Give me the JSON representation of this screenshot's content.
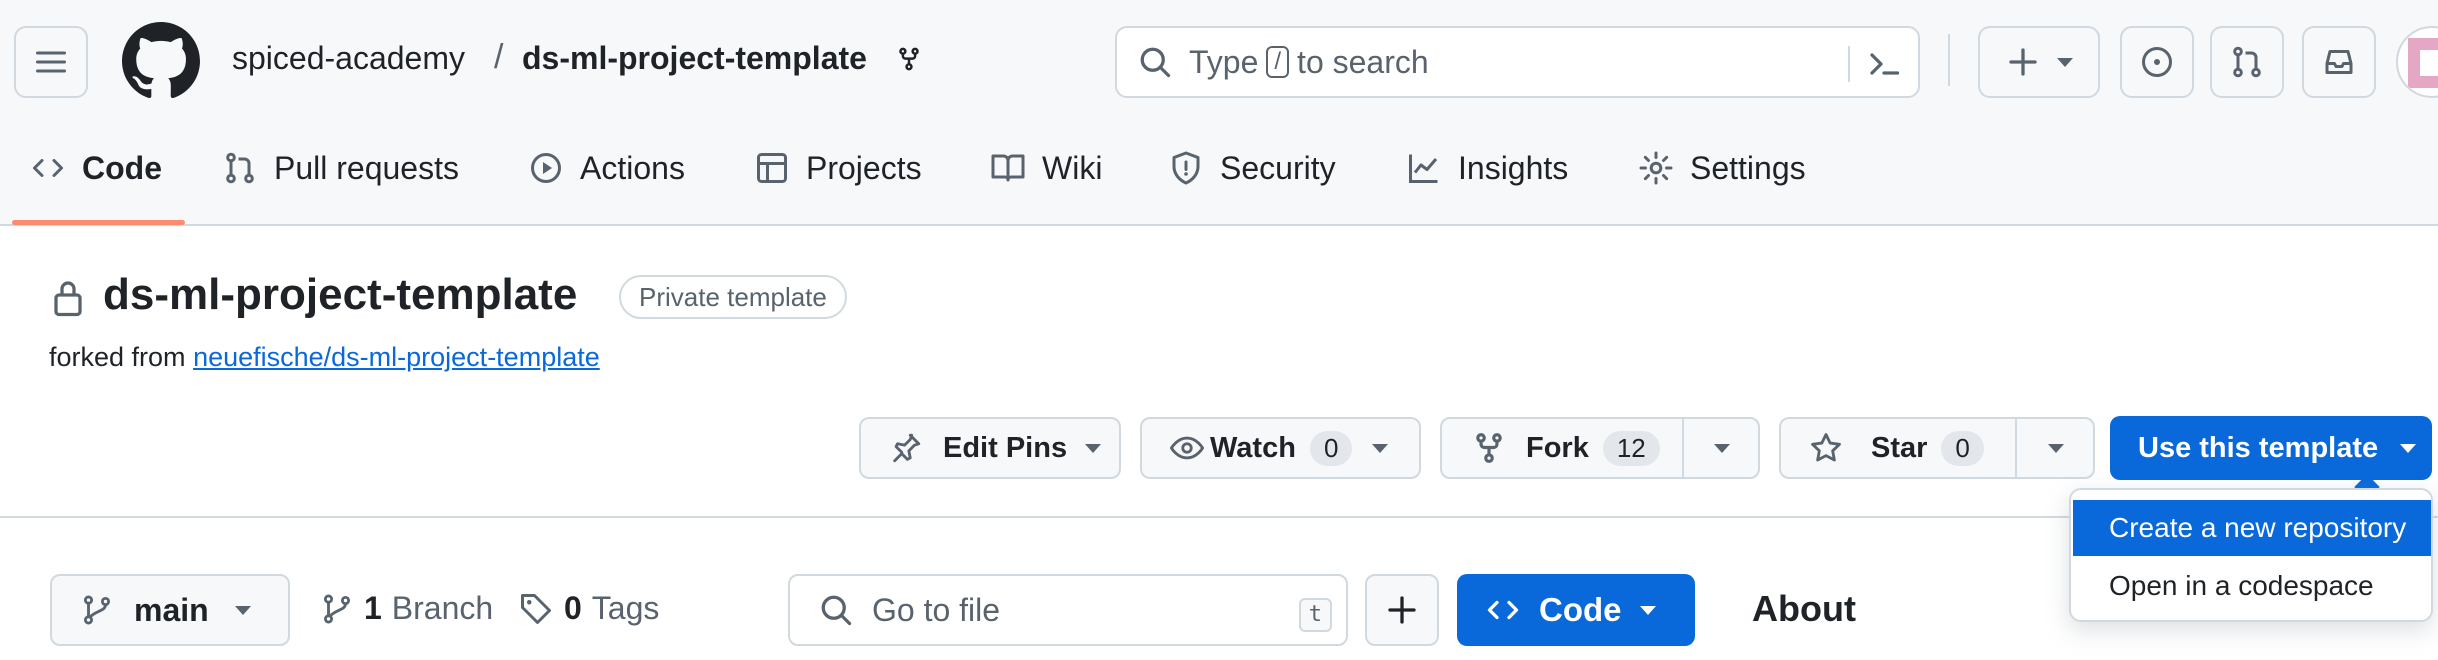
{
  "header": {
    "owner": "spiced-academy",
    "separator": "/",
    "repo": "ds-ml-project-template",
    "search_placeholder_before": "Type",
    "search_key": "/",
    "search_placeholder_after": "to search"
  },
  "nav": {
    "code": "Code",
    "pull_requests": "Pull requests",
    "actions": "Actions",
    "projects": "Projects",
    "wiki": "Wiki",
    "security": "Security",
    "insights": "Insights",
    "settings": "Settings"
  },
  "repo_title": {
    "name": "ds-ml-project-template",
    "visibility_badge": "Private template",
    "forked_prefix": "forked from",
    "forked_link": "neuefische/ds-ml-project-template"
  },
  "actions": {
    "edit_pins": "Edit Pins",
    "watch": "Watch",
    "watch_count": "0",
    "fork": "Fork",
    "fork_count": "12",
    "star": "Star",
    "star_count": "0",
    "use_template": "Use this template"
  },
  "template_menu": {
    "create_repo": "Create a new repository",
    "open_codespace": "Open in a codespace"
  },
  "files_bar": {
    "branch": "main",
    "branch_count": "1",
    "branch_label": "Branch",
    "tag_count": "0",
    "tag_label": "Tags",
    "goto_placeholder": "Go to file",
    "goto_key": "t",
    "code_button": "Code",
    "about_heading": "About"
  },
  "colors": {
    "accent": "#0969da",
    "active_tab_underline": "#fd8c73",
    "header_bg": "#f6f8fa",
    "border": "#d1d9e0"
  }
}
